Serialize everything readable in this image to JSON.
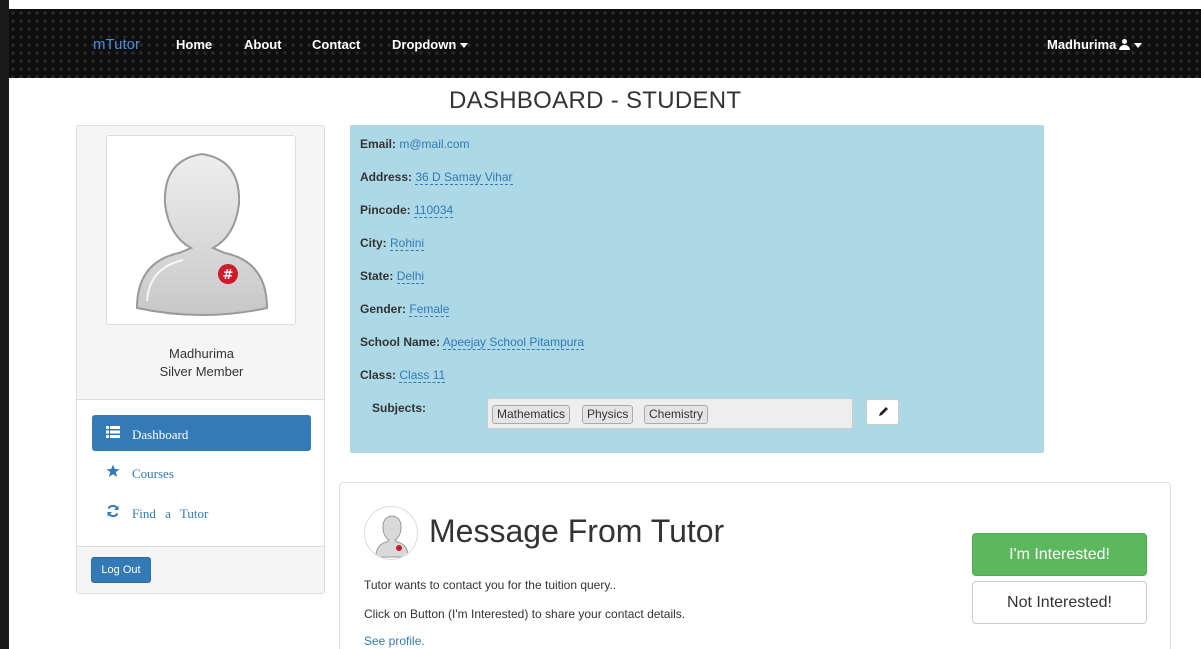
{
  "navbar": {
    "brand": "mTutor",
    "links": [
      "Home",
      "About",
      "Contact"
    ],
    "dropdown_label": "Dropdown",
    "user_label": "Madhurima"
  },
  "page_title": "DASHBOARD - STUDENT",
  "profile": {
    "name": "Madhurima",
    "level": "Silver Member"
  },
  "sidebar": {
    "items": [
      {
        "label": "Dashboard",
        "icon": "list-icon",
        "active": true
      },
      {
        "label": "Courses",
        "icon": "star-icon",
        "active": false
      },
      {
        "label": "Find a Tutor",
        "icon": "refresh-icon",
        "active": false
      }
    ],
    "logout_label": "Log Out"
  },
  "info": {
    "email": {
      "label": "Email:",
      "value": "m@mail.com"
    },
    "address": {
      "label": "Address:",
      "value": "36 D Samay Vihar"
    },
    "pincode": {
      "label": "Pincode:",
      "value": "110034"
    },
    "city": {
      "label": "City:",
      "value": "Rohini"
    },
    "state": {
      "label": "State:",
      "value": "Delhi"
    },
    "gender": {
      "label": "Gender:",
      "value": "Female"
    },
    "school": {
      "label": "School Name:",
      "value": "Apeejay School Pitampura"
    },
    "class": {
      "label": "Class:",
      "value": "Class 11"
    },
    "subjects_label": "Subjects:",
    "subjects": [
      "Mathematics",
      "Physics",
      "Chemistry"
    ]
  },
  "message": {
    "title": "Message From Tutor",
    "line1": "Tutor wants to contact you for the tuition query..",
    "line2": "Click on Button (I'm Interested) to share your contact details.",
    "link": "See profile.",
    "interested_label": "I'm Interested!",
    "not_interested_label": "Not Interested!"
  },
  "colors": {
    "primary": "#337ab7",
    "success": "#5cb85c",
    "info_bg": "#add8e6",
    "navbar_bg": "#0e0e0e"
  }
}
